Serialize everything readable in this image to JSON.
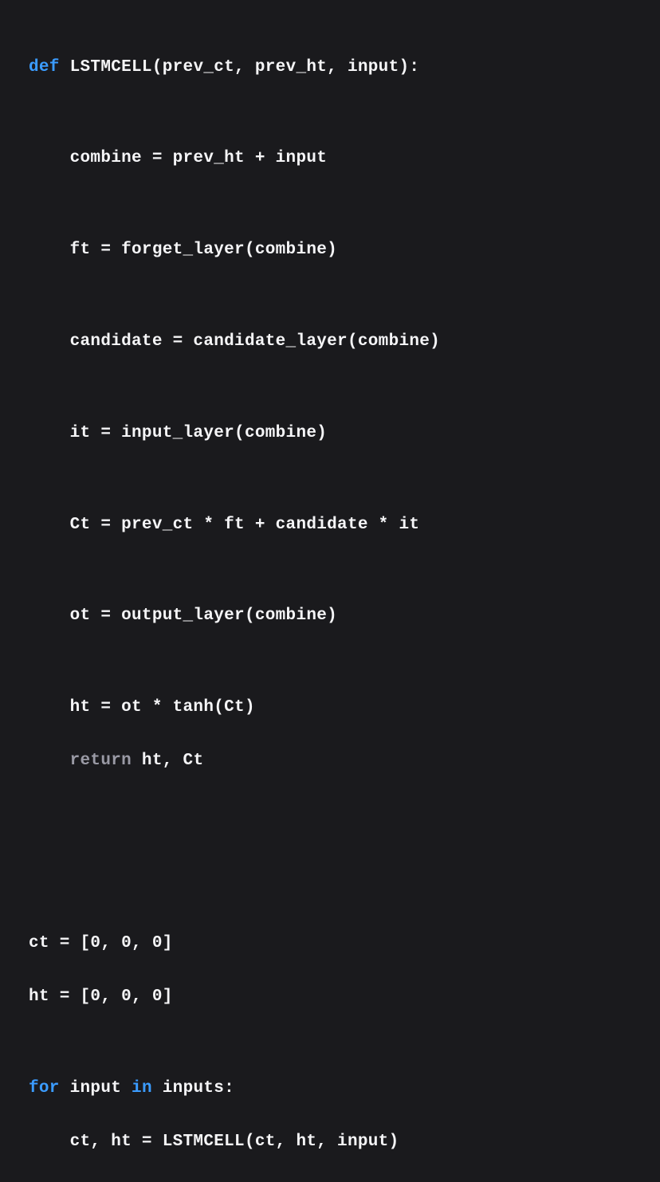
{
  "code": {
    "def_kw": "def",
    "fn_sig": " LSTMCELL(prev_ct, prev_ht, input):",
    "l_combine": "    combine = prev_ht + input",
    "l_ft": "    ft = forget_layer(combine)",
    "l_candidate": "    candidate = candidate_layer(combine)",
    "l_it": "    it = input_layer(combine)",
    "l_Ct": "    Ct = prev_ct * ft + candidate * it",
    "l_ot": "    ot = output_layer(combine)",
    "l_ht": "    ht = ot * tanh(Ct)",
    "return_kw": "    return",
    "return_rest": " ht, Ct",
    "l_ct_init": "ct = [0, 0, 0]",
    "l_ht_init": "ht = [0, 0, 0]",
    "for_kw": "for",
    "for_mid": " input ",
    "in_kw": "in",
    "for_rest": " inputs:",
    "l_loop_body": "    ct, ht = LSTMCELL(ct, ht, input)"
  }
}
